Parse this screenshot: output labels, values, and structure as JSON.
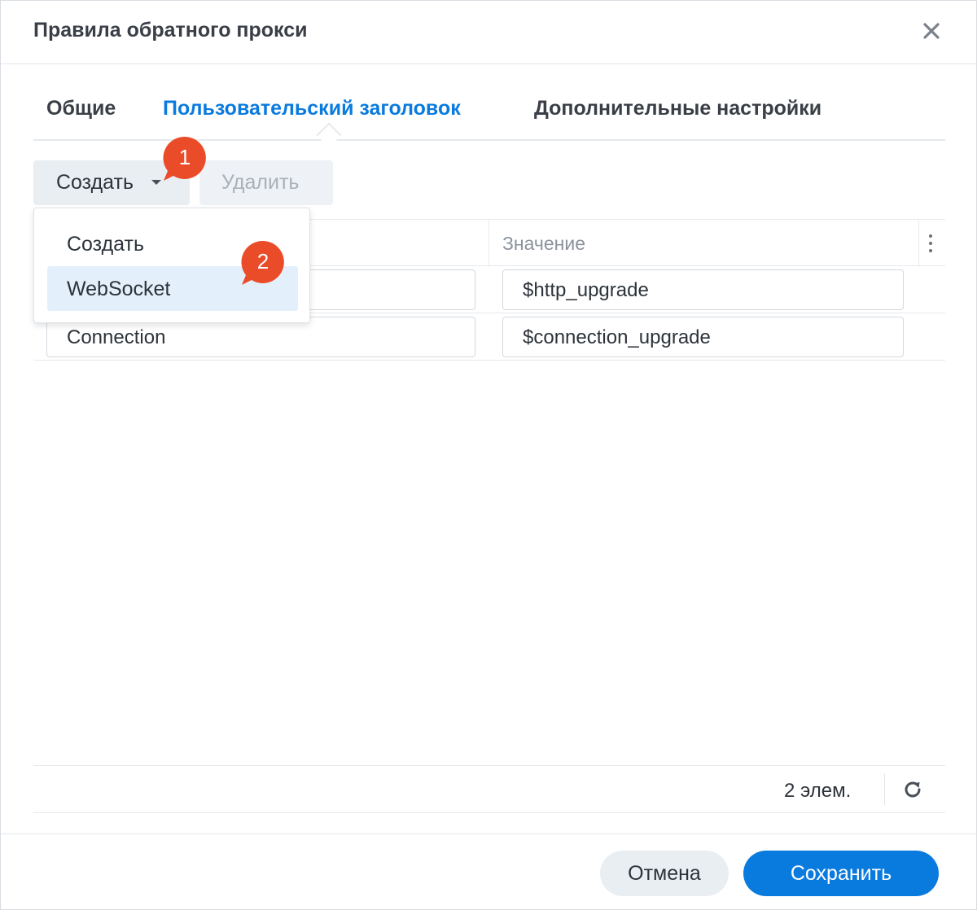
{
  "dialog": {
    "title": "Правила обратного прокси",
    "close_icon": "close-icon"
  },
  "tabs": [
    {
      "label": "Общие",
      "active": false
    },
    {
      "label": "Пользовательский заголовок",
      "active": true
    },
    {
      "label": "Дополнительные настройки",
      "active": false
    }
  ],
  "toolbar": {
    "create_label": "Создать",
    "delete_label": "Удалить",
    "delete_disabled": true
  },
  "menu": {
    "items": [
      {
        "label": "Создать",
        "highlighted": false
      },
      {
        "label": "WebSocket",
        "highlighted": true
      }
    ]
  },
  "grid": {
    "columns": [
      "",
      "Значение"
    ],
    "rows": [
      {
        "name": "",
        "value": "$http_upgrade"
      },
      {
        "name": "Connection",
        "value": "$connection_upgrade"
      }
    ],
    "count_label": "2 элем."
  },
  "buttons": {
    "cancel_label": "Отмена",
    "save_label": "Сохранить"
  },
  "badges": [
    {
      "label": "1"
    },
    {
      "label": "2"
    }
  ],
  "colors": {
    "accent": "#0a7bde",
    "badge": "#ea4c2a",
    "menu_highlight": "#e3f0fc"
  }
}
